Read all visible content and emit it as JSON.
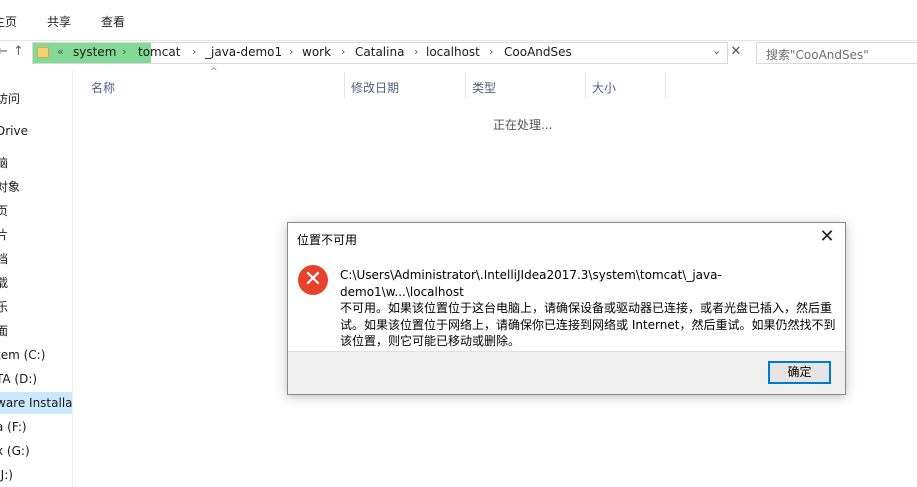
{
  "ribbon": {
    "tabs": [
      "主页",
      "共享",
      "查看"
    ]
  },
  "nav": {
    "back_icon": "←",
    "up_icon": "↑"
  },
  "address": {
    "overflow": "«",
    "crumbs": [
      "system",
      "tomcat",
      "_java-demo1",
      "work",
      "Catalina",
      "localhost",
      "CooAndSes"
    ],
    "separator": "›",
    "dropdown_icon": "⌄",
    "clear_icon": "✕"
  },
  "search": {
    "placeholder": "搜索\"CooAndSes\""
  },
  "sidebar": {
    "items": [
      {
        "label": "访问",
        "selected": false
      },
      {
        "label": "Drive",
        "selected": false
      },
      {
        "label": "脑",
        "selected": false
      },
      {
        "label": "对象",
        "selected": false
      },
      {
        "label": "页",
        "selected": false
      },
      {
        "label": "片",
        "selected": false
      },
      {
        "label": "档",
        "selected": false
      },
      {
        "label": "载",
        "selected": false
      },
      {
        "label": "乐",
        "selected": false
      },
      {
        "label": "面",
        "selected": false
      },
      {
        "label": "tem (C:)",
        "selected": false
      },
      {
        "label": "TA (D:)",
        "selected": false
      },
      {
        "label": "ware Installa",
        "selected": true
      },
      {
        "label": "a (F:)",
        "selected": false
      },
      {
        "label": "x (G:)",
        "selected": false
      },
      {
        "label": "(J:)",
        "selected": false
      }
    ]
  },
  "columns": {
    "name": "名称",
    "modified": "修改日期",
    "type": "类型",
    "size": "大小"
  },
  "status": {
    "working": "正在处理..."
  },
  "dialog": {
    "title": "位置不可用",
    "close_icon": "✕",
    "icon": "error-icon",
    "message_lines": [
      "C:\\Users\\Administrator\\.IntelliJIdea2017.3\\system\\tomcat\\_java-demo1\\w...\\localhost",
      "不可用。如果该位置位于这台电脑上，请确保设备或驱动器已连接，或者光盘已插入，然后重",
      "试。如果该位置位于网络上，请确保你已连接到网络或 Internet，然后重试。如果仍然找不到",
      "该位置，则它可能已移动或删除。"
    ],
    "ok_label": "确定"
  }
}
